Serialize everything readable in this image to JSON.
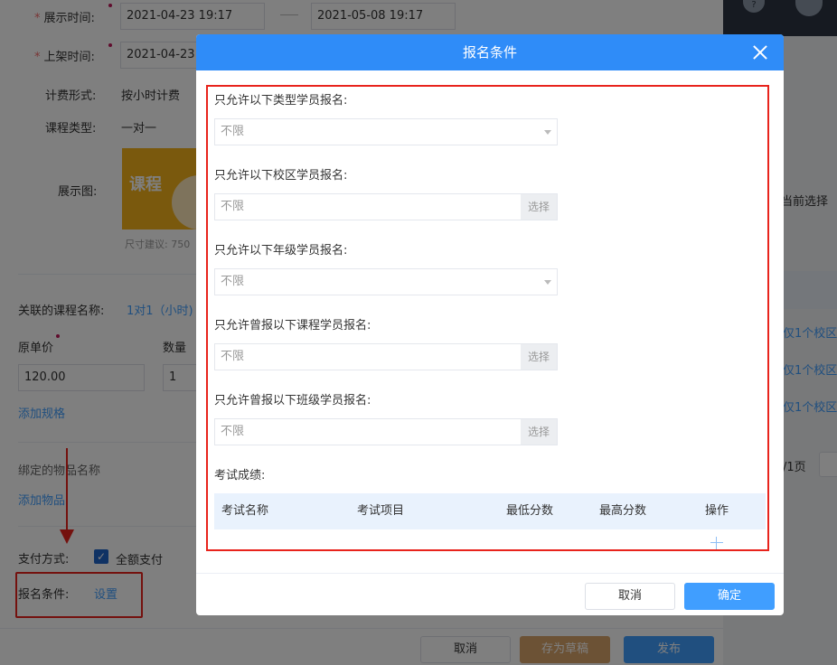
{
  "form": {
    "display_time_label": "展示时间:",
    "display_time_start": "2021-04-23 19:17",
    "display_time_end": "2021-05-08 19:17",
    "shelf_time_label": "上架时间:",
    "shelf_time_value": "2021-04-23",
    "billing_label": "计费形式:",
    "billing_value": "按小时计费",
    "course_type_label": "课程类型:",
    "course_type_value": "一对一",
    "display_image_label": "展示图:",
    "thumb_text": "课程",
    "size_hint": "尺寸建议: 750",
    "linked_course_label": "关联的课程名称:",
    "linked_course_value": "1对1（小时)",
    "original_price_label": "原单价",
    "original_price_value": "120.00",
    "quantity_label": "数量",
    "quantity_value": "1",
    "add_spec_link": "添加规格",
    "bound_item_label": "绑定的物品名称",
    "add_item_link": "添加物品",
    "payment_label": "支付方式:",
    "payment_option": "全额支付",
    "enroll_cond_label": "报名条件:",
    "enroll_cond_link": "设置",
    "check_glyph": "✓"
  },
  "footer": {
    "cancel": "取消",
    "save_draft": "存为草稿",
    "publish": "发布"
  },
  "right_panel": {
    "help_glyph": "?",
    "current_select": "当前选择",
    "campus_1": "仅1个校区",
    "campus_2": "仅1个校区",
    "campus_3": "仅1个校区",
    "page_text": "/1页"
  },
  "dialog": {
    "title": "报名条件",
    "fields": [
      {
        "label": "只允许以下类型学员报名:",
        "value": "不限",
        "control": "select"
      },
      {
        "label": "只允许以下校区学员报名:",
        "value": "不限",
        "control": "choose",
        "button": "选择"
      },
      {
        "label": "只允许以下年级学员报名:",
        "value": "不限",
        "control": "select"
      },
      {
        "label": "只允许曾报以下课程学员报名:",
        "value": "不限",
        "control": "choose",
        "button": "选择"
      },
      {
        "label": "只允许曾报以下班级学员报名:",
        "value": "不限",
        "control": "choose",
        "button": "选择"
      }
    ],
    "exam_label": "考试成绩:",
    "table_headers": [
      "考试名称",
      "考试项目",
      "最低分数",
      "最高分数",
      "操作"
    ],
    "cancel": "取消",
    "confirm": "确定"
  },
  "colors": {
    "dialog_header": "#2f8cf8",
    "primary": "#409eff",
    "annotation_red": "#e8231c",
    "draft_button": "#d9a56a"
  }
}
